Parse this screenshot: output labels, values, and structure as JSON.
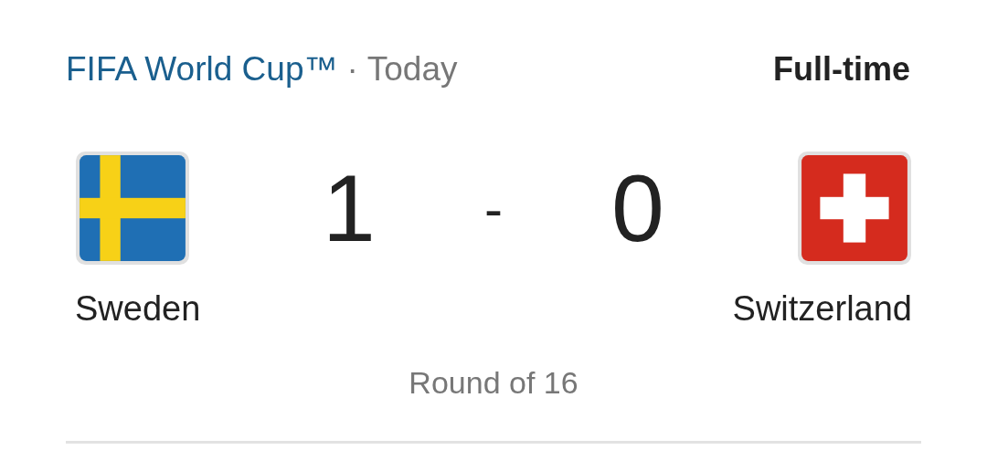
{
  "header": {
    "competition": "FIFA World Cup™",
    "separator": "·",
    "date": "Today",
    "status": "Full-time"
  },
  "home": {
    "name": "Sweden",
    "score": "1"
  },
  "score_separator": "-",
  "away": {
    "name": "Switzerland",
    "score": "0"
  },
  "round": "Round of 16"
}
